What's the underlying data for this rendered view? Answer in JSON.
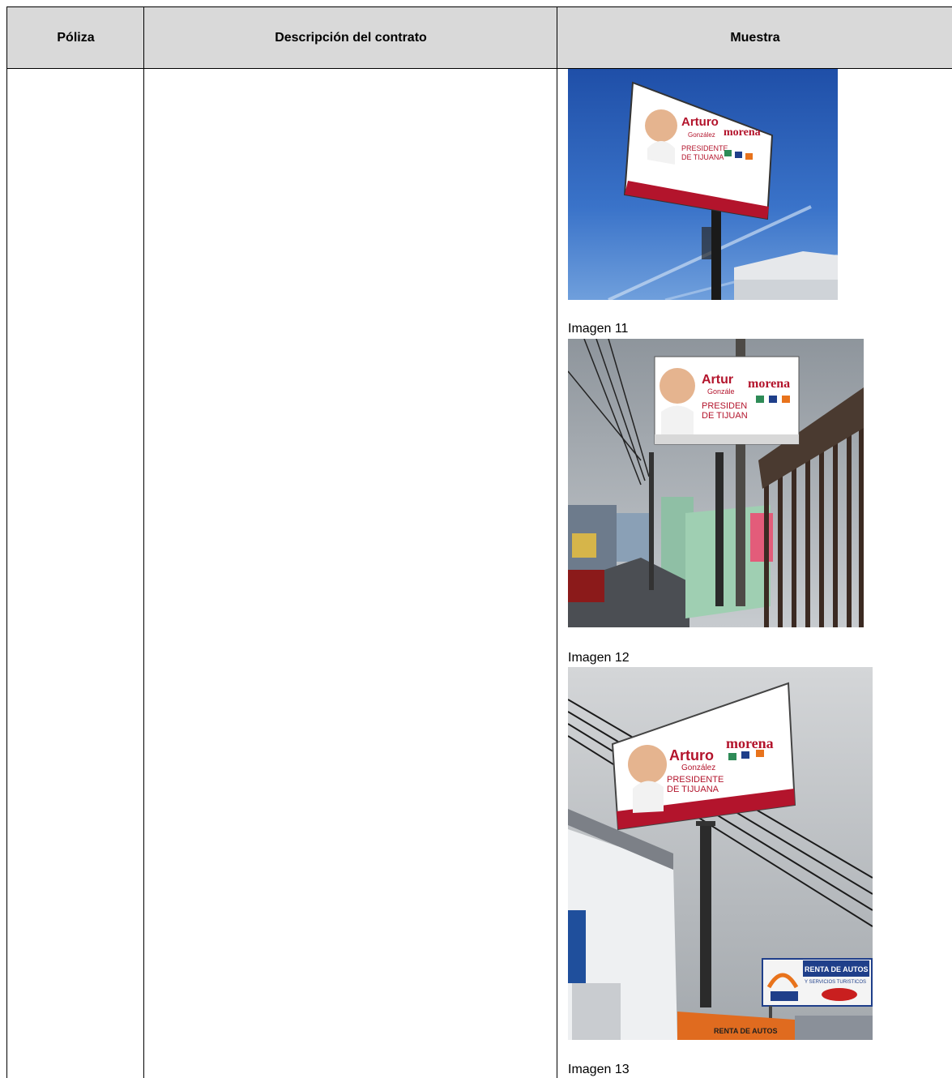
{
  "table": {
    "headers": {
      "poliza": "Póliza",
      "descripcion": "Descripción del contrato",
      "muestra": "Muestra"
    }
  },
  "images": [
    {
      "caption": "Imagen 11",
      "billboard": {
        "name_first": "Arturo",
        "name_last": "González",
        "party": "morena",
        "line1": "PRESIDENTE",
        "line2": "DE TIJUANA"
      }
    },
    {
      "caption": "Imagen 12",
      "billboard": {
        "name_first": "Artur",
        "name_last": "Gonzále",
        "party": "morena",
        "line1": "PRESIDEN",
        "line2": "DE TIJUAN"
      }
    },
    {
      "caption": "Imagen 13",
      "billboard": {
        "name_first": "Arturo",
        "name_last": "González",
        "party": "morena",
        "line1": "PRESIDENTE",
        "line2": "DE TIJUANA"
      },
      "sign": {
        "title": "RENTA DE AUTOS",
        "subtitle": "Y SERVICIOS TURISTICOS",
        "awning": "RENTA DE AUTOS"
      }
    }
  ]
}
